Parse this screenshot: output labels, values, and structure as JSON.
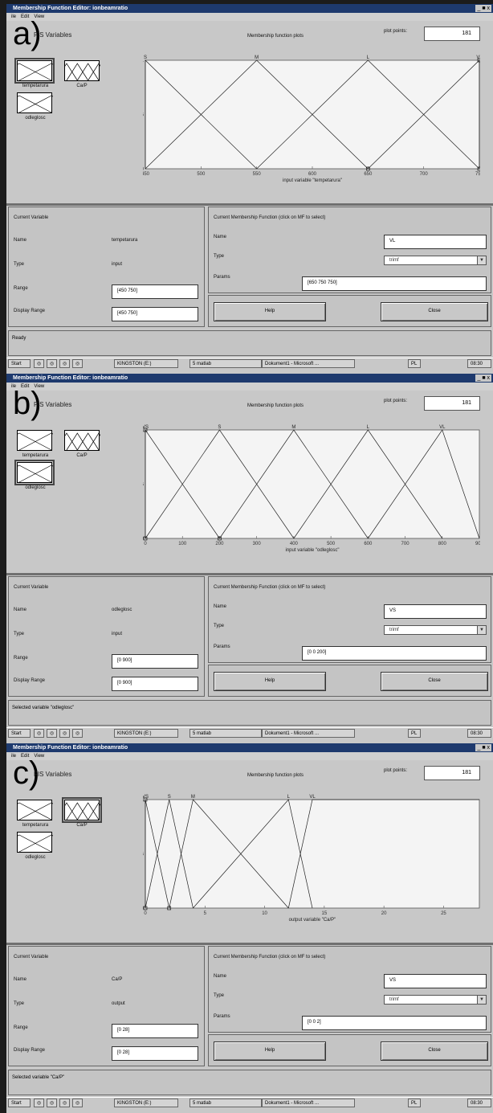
{
  "window_title": "Membership Function Editor: ionbeamratio",
  "window_buttons": "_ ■ x",
  "menu": [
    "ile",
    "Edit",
    "View"
  ],
  "fis_variables_label": "FIS Variables",
  "plot_title": "Membership function plots",
  "plot_points_label": "plot points:",
  "plot_points_value": "181",
  "current_variable_header": "Current Variable",
  "cmf_header": "Current Membership Function (click on MF to select)",
  "labels": {
    "name": "Name",
    "type": "Type",
    "range": "Range",
    "display_range": "Display Range",
    "params": "Params"
  },
  "buttons": {
    "help": "Help",
    "close": "Close"
  },
  "taskbar": {
    "start": "Start",
    "kingston": "KINGSTON (E:)",
    "matlab": "5 matlab",
    "word": "Dokument1 - Microsoft ...",
    "lang": "PL",
    "clock": "08:30"
  },
  "panels": [
    {
      "letter": "a)",
      "variables": [
        {
          "name": "tempetarura",
          "selected": true
        },
        {
          "name": "Ca/P",
          "selected": false
        },
        {
          "name": "odleglosc",
          "selected": false
        }
      ],
      "current_name": "tempetarura",
      "current_type": "input",
      "range": "[450 750]",
      "display_range": "[450 750]",
      "mf_name": "VL",
      "mf_type": "trimf",
      "params": "[650 750 750]",
      "status": "Ready",
      "chart_data": {
        "type": "line",
        "xlabel": "input variable \"tempetarura\"",
        "xlim": [
          450,
          750
        ],
        "ylim": [
          0,
          1
        ],
        "xticks": [
          450,
          500,
          550,
          600,
          650,
          700,
          750
        ],
        "yticks": [
          0,
          0.5,
          1
        ],
        "series": [
          {
            "name": "S",
            "x": [
              450,
              450,
              550
            ],
            "y": [
              0,
              1,
              0
            ]
          },
          {
            "name": "M",
            "x": [
              450,
              550,
              650
            ],
            "y": [
              0,
              1,
              0
            ]
          },
          {
            "name": "L",
            "x": [
              550,
              650,
              750
            ],
            "y": [
              0,
              1,
              0
            ]
          },
          {
            "name": "VL",
            "x": [
              650,
              750,
              750
            ],
            "y": [
              0,
              1,
              0
            ]
          }
        ]
      }
    },
    {
      "letter": "b)",
      "variables": [
        {
          "name": "tempetarura",
          "selected": false
        },
        {
          "name": "Ca/P",
          "selected": false
        },
        {
          "name": "odleglosc",
          "selected": true
        }
      ],
      "current_name": "odleglosc",
      "current_type": "input",
      "range": "[0 900]",
      "display_range": "[0 900]",
      "mf_name": "VS",
      "mf_type": "trimf",
      "params": "[0 0 200]",
      "status": "Selected variable \"odleglosc\"",
      "chart_data": {
        "type": "line",
        "xlabel": "input variable \"odleglosc\"",
        "xlim": [
          0,
          900
        ],
        "ylim": [
          0,
          1
        ],
        "xticks": [
          0,
          100,
          200,
          300,
          400,
          500,
          600,
          700,
          800,
          900
        ],
        "yticks": [
          0,
          0.5,
          1
        ],
        "series": [
          {
            "name": "VS",
            "x": [
              0,
              0,
              200
            ],
            "y": [
              0,
              1,
              0
            ]
          },
          {
            "name": "S",
            "x": [
              0,
              200,
              400
            ],
            "y": [
              0,
              1,
              0
            ]
          },
          {
            "name": "M",
            "x": [
              200,
              400,
              600
            ],
            "y": [
              0,
              1,
              0
            ]
          },
          {
            "name": "L",
            "x": [
              400,
              600,
              800
            ],
            "y": [
              0,
              1,
              0
            ]
          },
          {
            "name": "VL",
            "x": [
              600,
              800,
              900
            ],
            "y": [
              0,
              1,
              0
            ]
          }
        ]
      }
    },
    {
      "letter": "c)",
      "variables": [
        {
          "name": "tempetarura",
          "selected": false
        },
        {
          "name": "Ca/P",
          "selected": true
        },
        {
          "name": "odleglosc",
          "selected": false
        }
      ],
      "current_name": "Ca/P",
      "current_type": "output",
      "range": "[0 28]",
      "display_range": "[0 28]",
      "mf_name": "VS",
      "mf_type": "trimf",
      "params": "[0 0 2]",
      "status": "Selected variable \"Ca/P\"",
      "chart_data": {
        "type": "line",
        "xlabel": "output variable \"Ca/P\"",
        "xlim": [
          0,
          28
        ],
        "ylim": [
          0,
          1
        ],
        "xticks": [
          0,
          5,
          10,
          15,
          20,
          25
        ],
        "yticks": [
          0,
          0.5,
          1
        ],
        "series": [
          {
            "name": "VS",
            "x": [
              0,
              0,
              2
            ],
            "y": [
              0,
              1,
              0
            ]
          },
          {
            "name": "S",
            "x": [
              0,
              2,
              4
            ],
            "y": [
              0,
              1,
              0
            ]
          },
          {
            "name": "M",
            "x": [
              2,
              4,
              12
            ],
            "y": [
              0,
              1,
              0
            ]
          },
          {
            "name": "L",
            "x": [
              4,
              12,
              14
            ],
            "y": [
              0,
              1,
              0
            ]
          },
          {
            "name": "VL",
            "x": [
              12,
              14,
              28
            ],
            "y": [
              0,
              1,
              1
            ]
          }
        ]
      }
    }
  ]
}
